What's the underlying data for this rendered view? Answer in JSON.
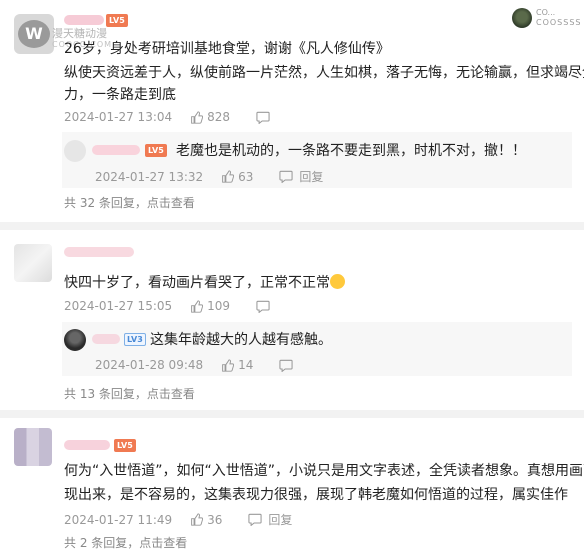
{
  "watermark": {
    "line1": "漫天糖动漫",
    "line2": "COOCO.COM"
  },
  "top_right": {
    "line1": "CO...",
    "line2": "COOSSSS"
  },
  "comments": [
    {
      "badge": "LV5",
      "lines": [
        "26岁，身处考研培训基地食堂，谢谢《凡人修仙传》",
        "纵使天资远差于人，纵使前路一片茫然，人生如棋，落子无悔，无论输赢，但求竭尽全",
        "力，一条路走到底"
      ],
      "date": "2024-01-27 13:04",
      "likes": "828",
      "reply": {
        "badge": "LV5",
        "text": "老魔也是机动的，一条路不要走到黑，时机不对，撤！！",
        "date": "2024-01-27 13:32",
        "likes": "63",
        "reply_label": "回复"
      },
      "thread_summary": "共 32 条回复，点击查看"
    },
    {
      "badge": "",
      "lines": [
        "快四十岁了，看动画片看哭了，正常不正常"
      ],
      "date": "2024-01-27 15:05",
      "likes": "109",
      "reply": {
        "badge": "LV3",
        "text": "这集年龄越大的人越有感触。",
        "date": "2024-01-28 09:48",
        "likes": "14",
        "reply_label": "回复"
      },
      "thread_summary": "共 13 条回复，点击查看"
    },
    {
      "badge": "LV5",
      "lines": [
        "何为“入世悟道”，如何“入世悟道”，小说只是用文字表述，全凭读者想象。真想用画面展",
        "现出来，是不容易的，这集表现力很强，展现了韩老魔如何悟道的过程，属实佳作"
      ],
      "date": "2024-01-27 11:49",
      "likes": "36",
      "reply_label": "回复",
      "thread_summary": "共 2 条回复，点击查看"
    }
  ],
  "colors": {
    "accent": "#f07a52",
    "meta": "#999999",
    "body": "#222222"
  }
}
